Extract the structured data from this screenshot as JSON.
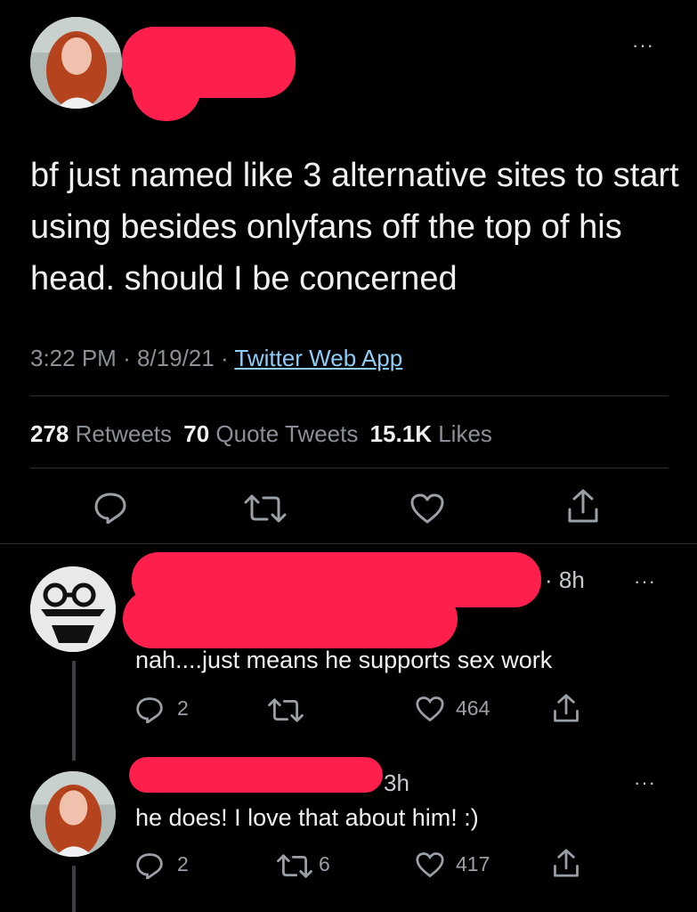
{
  "tweet": {
    "text": "bf just named like 3 alternative sites to start using besides onlyfans off the top of his head. should I be concerned",
    "time": "3:22 PM",
    "sep1": "·",
    "date": "8/19/21",
    "sep2": "·",
    "source": "Twitter Web App",
    "stats": {
      "retweets_count": "278",
      "retweets_label": "Retweets",
      "quotes_count": "70",
      "quotes_label": "Quote Tweets",
      "likes_count": "15.1K",
      "likes_label": "Likes"
    },
    "more": "···"
  },
  "replies": [
    {
      "time": "· 8h",
      "text": "nah....just means he supports sex work",
      "reply_count": "2",
      "retweet_count": "",
      "like_count": "464",
      "more": "···"
    },
    {
      "time": "3h",
      "text": "he does! I love that about him! :)",
      "reply_count": "2",
      "retweet_count": "6",
      "like_count": "417",
      "more": "···"
    }
  ],
  "colors": {
    "background": "#000000",
    "link": "#8ecdf8",
    "redaction": "#ff1f4d"
  }
}
